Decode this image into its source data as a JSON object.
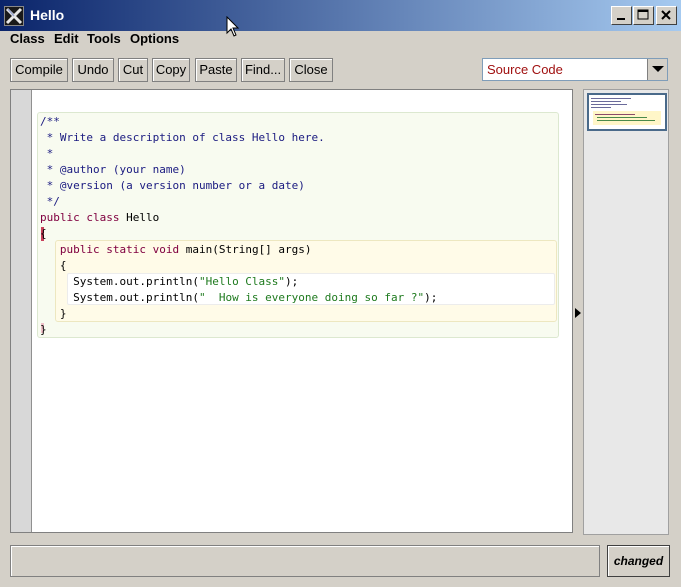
{
  "window": {
    "title": "Hello",
    "controls": [
      "minimize-icon",
      "maximize-icon",
      "close-icon"
    ]
  },
  "menu": {
    "items": [
      {
        "label": "Class"
      },
      {
        "label": "Edit"
      },
      {
        "label": "Tools"
      },
      {
        "label": "Options"
      }
    ]
  },
  "toolbar": {
    "buttons": [
      {
        "label": "Compile"
      },
      {
        "label": "Undo"
      },
      {
        "label": "Cut"
      },
      {
        "label": "Copy"
      },
      {
        "label": "Paste"
      },
      {
        "label": "Find..."
      },
      {
        "label": "Close"
      }
    ],
    "view_selector": {
      "value": "Source Code"
    }
  },
  "editor": {
    "lines": [
      "/**",
      " * Write a description of class Hello here.",
      " *",
      " * @author (your name)",
      " * @version (a version number or a date)",
      " */",
      "public class Hello",
      "{",
      "   public static void main(String[] args)",
      "   {",
      "     System.out.println(\"Hello Class\");",
      "     System.out.println(\"  How is everyone doing so far ?\");",
      "   }",
      "}"
    ]
  },
  "status": {
    "message": "",
    "changed_label": "changed"
  },
  "colors": {
    "titlebar_start": "#0a246a",
    "comment": "#1a1a80",
    "keyword": "#800040",
    "string": "#1e7a1e"
  }
}
